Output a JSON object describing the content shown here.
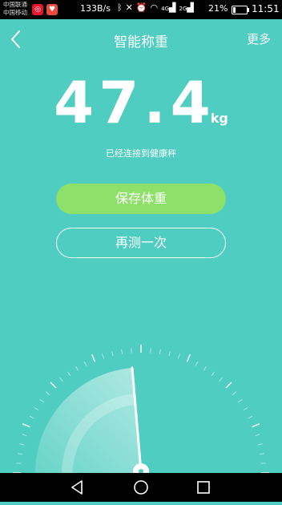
{
  "status_bar": {
    "carrier_1": "中国联通",
    "carrier_2": "中国移动",
    "net_speed": "133B/s",
    "network_4g": "4G",
    "network_2g": "2G",
    "battery_percent": "21%",
    "battery_level": 0.21,
    "time": "11:51"
  },
  "header": {
    "title": "智能称重",
    "more_label": "更多"
  },
  "measurement": {
    "value": "47.4",
    "unit": "kg",
    "status": "已经连接到健康秤"
  },
  "actions": {
    "save_label": "保存体重",
    "retest_label": "再测一次"
  },
  "colors": {
    "background": "#4ecdc0",
    "save_button": "#8fe06a",
    "status_bar": "#000000"
  },
  "icons": {
    "back": "chevron-left-icon",
    "nav_back": "triangle-back-icon",
    "nav_home": "circle-home-icon",
    "nav_recent": "square-recent-icon"
  }
}
